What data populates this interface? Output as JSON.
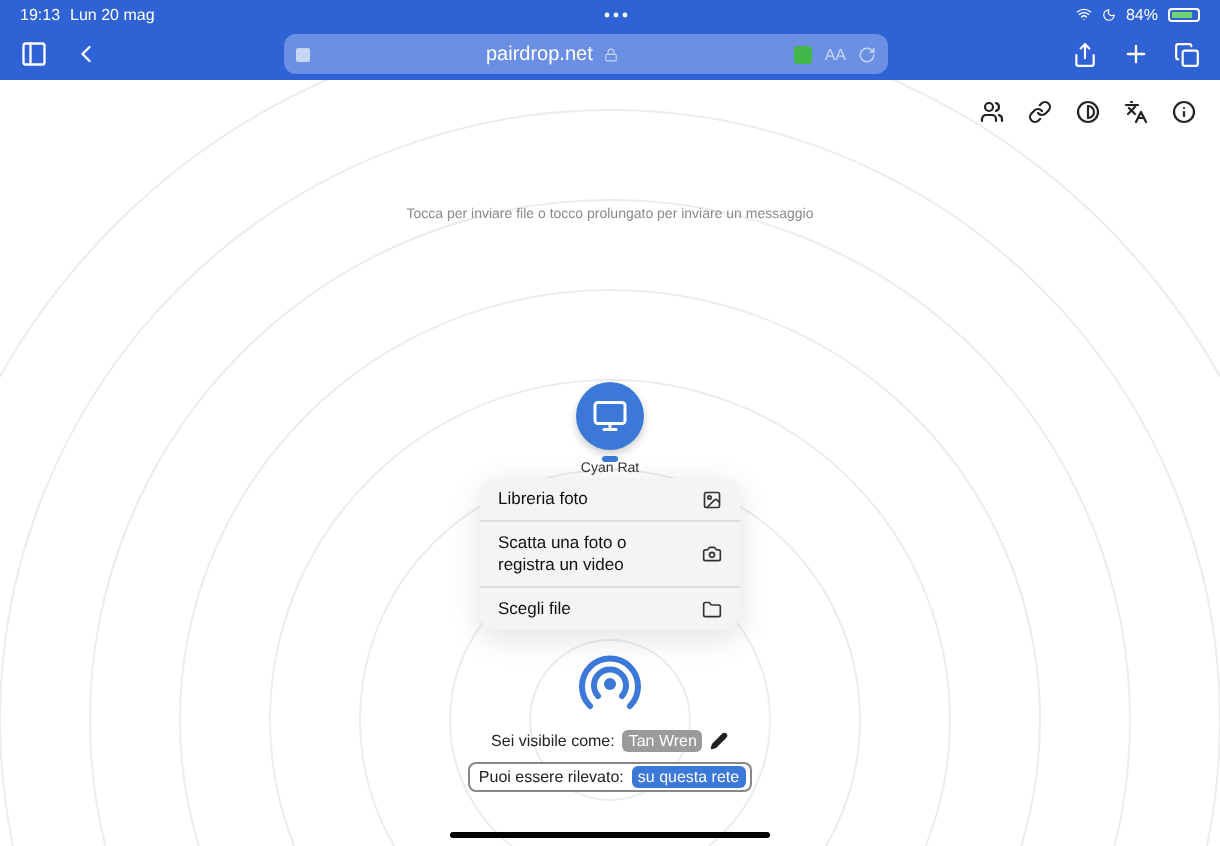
{
  "status_bar": {
    "time": "19:13",
    "date": "Lun 20 mag",
    "battery": "84%"
  },
  "browser": {
    "url": "pairdrop.net",
    "text_size": "AA"
  },
  "hint": "Tocca per inviare file o tocco prolungato per inviare un messaggio",
  "peer": {
    "name": "Cyan Rat"
  },
  "menu": [
    {
      "label": "Libreria foto",
      "kind": "photos"
    },
    {
      "label": "Scatta una foto o registra un video",
      "kind": "camera"
    },
    {
      "label": "Scegli file",
      "kind": "folder"
    }
  ],
  "self": {
    "prefix": "Sei visibile come:",
    "name": "Tan Wren"
  },
  "discovery": {
    "label": "Puoi essere rilevato:",
    "scope": "su questa rete"
  }
}
